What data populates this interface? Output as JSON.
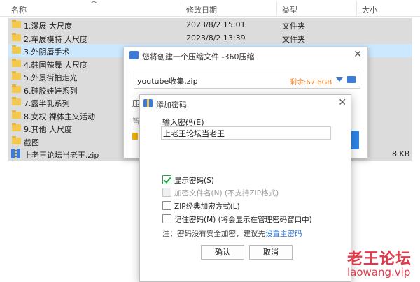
{
  "explorer": {
    "columns": {
      "name": "名称",
      "date": "修改日期",
      "type": "类型",
      "size": "大小"
    },
    "rows": [
      {
        "name": "1.漫展 大尺度",
        "date": "2023/8/2 15:01",
        "type": "文件夹",
        "size": "",
        "kind": "folder",
        "state": "hl"
      },
      {
        "name": "2.车展模特 大尺度",
        "date": "2023/8/2 13:39",
        "type": "文件夹",
        "size": "",
        "kind": "folder",
        "state": "hl"
      },
      {
        "name": "3.外阴唇手术",
        "date": "",
        "type": "",
        "size": "",
        "kind": "folder",
        "state": "sel"
      },
      {
        "name": "4.韩国辣舞 大尺度",
        "date": "",
        "type": "",
        "size": "",
        "kind": "folder",
        "state": "hl"
      },
      {
        "name": "5.外景街拍走光",
        "date": "",
        "type": "",
        "size": "",
        "kind": "folder",
        "state": "hl"
      },
      {
        "name": "6.硅胶娃娃系列",
        "date": "",
        "type": "",
        "size": "",
        "kind": "folder",
        "state": "hl"
      },
      {
        "name": "7.露半乳系列",
        "date": "",
        "type": "",
        "size": "",
        "kind": "folder",
        "state": "hl"
      },
      {
        "name": "8.女权 裸体主义活动",
        "date": "",
        "type": "",
        "size": "",
        "kind": "folder",
        "state": "hl"
      },
      {
        "name": "9.其他 大尺度",
        "date": "",
        "type": "",
        "size": "",
        "kind": "folder",
        "state": "hl"
      },
      {
        "name": "截图",
        "date": "",
        "type": "",
        "size": "",
        "kind": "folder",
        "state": "hl"
      },
      {
        "name": "上老王论坛当老王.zip",
        "date": "",
        "type": "",
        "size": "8 KB",
        "kind": "zip",
        "state": "hl"
      }
    ]
  },
  "compress_dialog": {
    "title": "您将创建一个压缩文件 -360压缩",
    "filename": "youtube收集.zip",
    "remaining": "剩余:67.6GB",
    "label_compress": "压",
    "label_hint": "智"
  },
  "password_dialog": {
    "title": "添加密码",
    "password_label": "输入密码(E)",
    "password_value": "上老王论坛当老王",
    "options": [
      {
        "label": "显示密码(S)",
        "checked": true,
        "disabled": false
      },
      {
        "label": "加密文件名(N) (不支持ZIP格式)",
        "checked": false,
        "disabled": true
      },
      {
        "label": "ZIP经典加密方式(L)",
        "checked": false,
        "disabled": false
      },
      {
        "label": "记住密码(M) (将会显示在管理密码窗口中)",
        "checked": false,
        "disabled": false
      }
    ],
    "note_prefix": "注：密码没有安全加密，建议先",
    "note_link": "设置主密码",
    "ok_label": "确认",
    "cancel_label": "取消"
  },
  "watermark": {
    "cn": "老王论坛",
    "en": "laowang.vip"
  },
  "colors": {
    "selection": "#cce8ff",
    "highlight": "#dcdcdc",
    "accent": "#3d7bd9",
    "warning": "#f07c20",
    "watermark": "#e13a4a"
  }
}
